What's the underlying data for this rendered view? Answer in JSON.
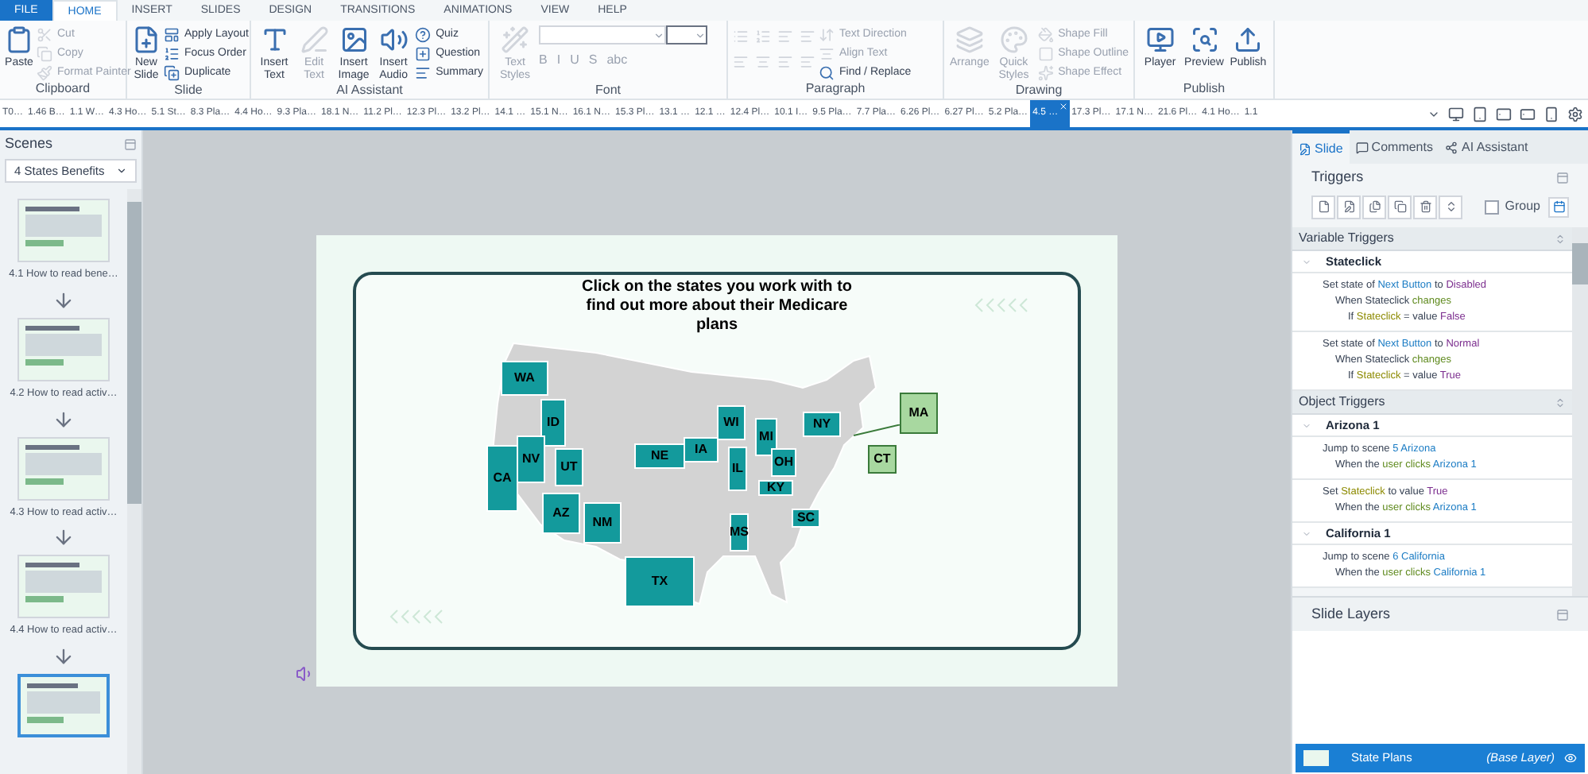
{
  "menu_tabs": [
    {
      "label": "FILE",
      "kind": "file",
      "selected": false
    },
    {
      "label": "HOME",
      "kind": "tab",
      "selected": true
    },
    {
      "label": "INSERT",
      "kind": "tab",
      "selected": false
    },
    {
      "label": "SLIDES",
      "kind": "tab",
      "selected": false
    },
    {
      "label": "DESIGN",
      "kind": "tab",
      "selected": false
    },
    {
      "label": "TRANSITIONS",
      "kind": "tab",
      "selected": false
    },
    {
      "label": "ANIMATIONS",
      "kind": "tab",
      "selected": false
    },
    {
      "label": "VIEW",
      "kind": "tab",
      "selected": false
    },
    {
      "label": "HELP",
      "kind": "tab",
      "selected": false
    }
  ],
  "ribbon": {
    "clipboard": {
      "label": "Clipboard",
      "large": [
        {
          "label": "Paste",
          "disabled": false
        }
      ],
      "small": [
        {
          "label": "Cut",
          "disabled": true
        },
        {
          "label": "Copy",
          "disabled": true
        },
        {
          "label": "Format Painter",
          "disabled": true
        }
      ]
    },
    "slide": {
      "label": "Slide",
      "large": [
        {
          "label": "New Slide",
          "disabled": false
        }
      ],
      "small": [
        {
          "label": "Apply Layout",
          "disabled": false
        },
        {
          "label": "Focus Order",
          "disabled": false
        },
        {
          "label": "Duplicate",
          "disabled": false
        }
      ]
    },
    "ai": {
      "label": "AI Assistant",
      "large": [
        {
          "label": "Insert Text",
          "disabled": false
        },
        {
          "label": "Edit Text",
          "disabled": true
        },
        {
          "label": "Insert Image",
          "disabled": false
        },
        {
          "label": "Insert Audio",
          "disabled": false
        }
      ],
      "small": [
        {
          "label": "Quiz",
          "disabled": false
        },
        {
          "label": "Question",
          "disabled": false
        },
        {
          "label": "Summary",
          "disabled": false
        }
      ]
    },
    "font": {
      "label": "Font",
      "large": [
        {
          "label": "Text Styles",
          "disabled": true
        }
      ],
      "glyphs": [
        "B",
        "I",
        "U",
        "S",
        "abc"
      ]
    },
    "paragraph": {
      "label": "Paragraph",
      "small": [
        {
          "label": "Text Direction",
          "disabled": true
        },
        {
          "label": "Align Text",
          "disabled": true
        },
        {
          "label": "Find / Replace",
          "disabled": false
        }
      ]
    },
    "drawing": {
      "label": "Drawing",
      "large": [
        {
          "label": "Arrange",
          "disabled": true
        },
        {
          "label": "Quick Styles",
          "disabled": true
        }
      ],
      "small": [
        {
          "label": "Shape Fill",
          "disabled": true
        },
        {
          "label": "Shape Outline",
          "disabled": true
        },
        {
          "label": "Shape Effect",
          "disabled": true
        }
      ]
    },
    "publish": {
      "label": "Publish",
      "large": [
        {
          "label": "Player",
          "disabled": false
        },
        {
          "label": "Preview",
          "disabled": false
        },
        {
          "label": "Publish",
          "disabled": false
        }
      ]
    }
  },
  "slide_tabs": [
    {
      "label": "T0…",
      "selected": false
    },
    {
      "label": "1.46 B…",
      "selected": false
    },
    {
      "label": "1.1 W…",
      "selected": false
    },
    {
      "label": "4.3 Ho…",
      "selected": false
    },
    {
      "label": "5.1 St…",
      "selected": false
    },
    {
      "label": "8.3 Pla…",
      "selected": false
    },
    {
      "label": "4.4 Ho…",
      "selected": false
    },
    {
      "label": "9.3 Pla…",
      "selected": false
    },
    {
      "label": "18.1 N…",
      "selected": false
    },
    {
      "label": "11.2 Pl…",
      "selected": false
    },
    {
      "label": "12.3 Pl…",
      "selected": false
    },
    {
      "label": "13.2 Pl…",
      "selected": false
    },
    {
      "label": "14.1 …",
      "selected": false
    },
    {
      "label": "15.1 N…",
      "selected": false
    },
    {
      "label": "16.1 N…",
      "selected": false
    },
    {
      "label": "15.3 Pl…",
      "selected": false
    },
    {
      "label": "13.1 …",
      "selected": false
    },
    {
      "label": "12.1 …",
      "selected": false
    },
    {
      "label": "12.4 Pl…",
      "selected": false
    },
    {
      "label": "10.1 I…",
      "selected": false
    },
    {
      "label": "9.5 Pla…",
      "selected": false
    },
    {
      "label": "7.7 Pla…",
      "selected": false
    },
    {
      "label": "6.26 Pl…",
      "selected": false
    },
    {
      "label": "6.27 Pl…",
      "selected": false
    },
    {
      "label": "5.2 Pla…",
      "selected": false
    },
    {
      "label": "4.5 …",
      "selected": true
    },
    {
      "label": "17.3 Pl…",
      "selected": false
    },
    {
      "label": "17.1 N…",
      "selected": false
    },
    {
      "label": "21.6 Pl…",
      "selected": false
    },
    {
      "label": "4.1 Ho…",
      "selected": false
    },
    {
      "label": "1.1",
      "selected": false
    }
  ],
  "scenes": {
    "title": "Scenes",
    "dropdown": "4 States Benefits",
    "thumbnails": [
      {
        "caption": "4.1 How to read bene…",
        "selected": false
      },
      {
        "caption": "4.2 How to read activ…",
        "selected": false
      },
      {
        "caption": "4.3 How to read activ…",
        "selected": false
      },
      {
        "caption": "4.4 How to read activ…",
        "selected": false
      },
      {
        "selected": true
      }
    ]
  },
  "slide_content": {
    "heading": "Click on the states you work with to find out more about their Medicare plans",
    "states": [
      {
        "label": "WA",
        "kind": "state"
      },
      {
        "label": "ID",
        "kind": "state"
      },
      {
        "label": "CA",
        "kind": "state"
      },
      {
        "label": "NV",
        "kind": "state"
      },
      {
        "label": "UT",
        "kind": "state"
      },
      {
        "label": "AZ",
        "kind": "state"
      },
      {
        "label": "NM",
        "kind": "state"
      },
      {
        "label": "TX",
        "kind": "state"
      },
      {
        "label": "NE",
        "kind": "state"
      },
      {
        "label": "IA",
        "kind": "state"
      },
      {
        "label": "WI",
        "kind": "state"
      },
      {
        "label": "MI",
        "kind": "state"
      },
      {
        "label": "IL",
        "kind": "state"
      },
      {
        "label": "OH",
        "kind": "state"
      },
      {
        "label": "KY",
        "kind": "state"
      },
      {
        "label": "NY",
        "kind": "state"
      },
      {
        "label": "MS",
        "kind": "state"
      },
      {
        "label": "SC",
        "kind": "state"
      },
      {
        "label": "MA",
        "kind": "callout"
      },
      {
        "label": "CT",
        "kind": "callout"
      }
    ]
  },
  "right_panel": {
    "tabs": [
      {
        "label": "Slide",
        "selected": true
      },
      {
        "label": "Comments",
        "selected": false
      },
      {
        "label": "AI Assistant",
        "selected": false
      }
    ],
    "triggers_title": "Triggers",
    "group_label": "Group",
    "group_checked": false,
    "sections": [
      {
        "title": "Variable Triggers",
        "groups": [
          {
            "name": "Stateclick",
            "expanded": true,
            "triggers": [
              [
                [
                  {
                    "text": "Set state of "
                  },
                  {
                    "text": "Next Button",
                    "kind": "object"
                  },
                  {
                    "text": " to "
                  },
                  {
                    "text": "Disabled",
                    "kind": "value"
                  }
                ],
                [
                  {
                    "text": "When Stateclick "
                  },
                  {
                    "text": "changes",
                    "kind": "event"
                  }
                ],
                [
                  {
                    "text": "If "
                  },
                  {
                    "text": "Stateclick",
                    "kind": "variable"
                  },
                  {
                    "text": " = value "
                  },
                  {
                    "text": "False",
                    "kind": "value"
                  }
                ]
              ],
              [
                [
                  {
                    "text": "Set state of "
                  },
                  {
                    "text": "Next Button",
                    "kind": "object"
                  },
                  {
                    "text": " to "
                  },
                  {
                    "text": "Normal",
                    "kind": "value"
                  }
                ],
                [
                  {
                    "text": "When Stateclick "
                  },
                  {
                    "text": "changes",
                    "kind": "event"
                  }
                ],
                [
                  {
                    "text": "If "
                  },
                  {
                    "text": "Stateclick",
                    "kind": "variable"
                  },
                  {
                    "text": " = value "
                  },
                  {
                    "text": "True",
                    "kind": "value"
                  }
                ]
              ]
            ]
          }
        ]
      },
      {
        "title": "Object Triggers",
        "groups": [
          {
            "name": "Arizona 1",
            "expanded": true,
            "triggers": [
              [
                [
                  {
                    "text": "Jump to scene "
                  },
                  {
                    "text": "5 Arizona",
                    "kind": "object"
                  }
                ],
                [
                  {
                    "text": "When the "
                  },
                  {
                    "text": "user clicks",
                    "kind": "event"
                  },
                  {
                    "text": " Arizona 1",
                    "kind": "object"
                  }
                ]
              ],
              [
                [
                  {
                    "text": "Set "
                  },
                  {
                    "text": "Stateclick",
                    "kind": "variable"
                  },
                  {
                    "text": " to value "
                  },
                  {
                    "text": "True",
                    "kind": "value"
                  }
                ],
                [
                  {
                    "text": "When the "
                  },
                  {
                    "text": "user clicks",
                    "kind": "event"
                  },
                  {
                    "text": " Arizona 1",
                    "kind": "object"
                  }
                ]
              ]
            ]
          },
          {
            "name": "California 1",
            "expanded": true,
            "triggers": [
              [
                [
                  {
                    "text": "Jump to scene "
                  },
                  {
                    "text": "6 California",
                    "kind": "object"
                  }
                ],
                [
                  {
                    "text": "When the "
                  },
                  {
                    "text": "user clicks",
                    "kind": "event"
                  },
                  {
                    "text": " California 1",
                    "kind": "object"
                  }
                ]
              ]
            ]
          }
        ]
      }
    ],
    "layers_title": "Slide Layers",
    "layers": [
      {
        "name": "State Plans",
        "note": "(Base Layer)",
        "selected": true
      }
    ]
  }
}
